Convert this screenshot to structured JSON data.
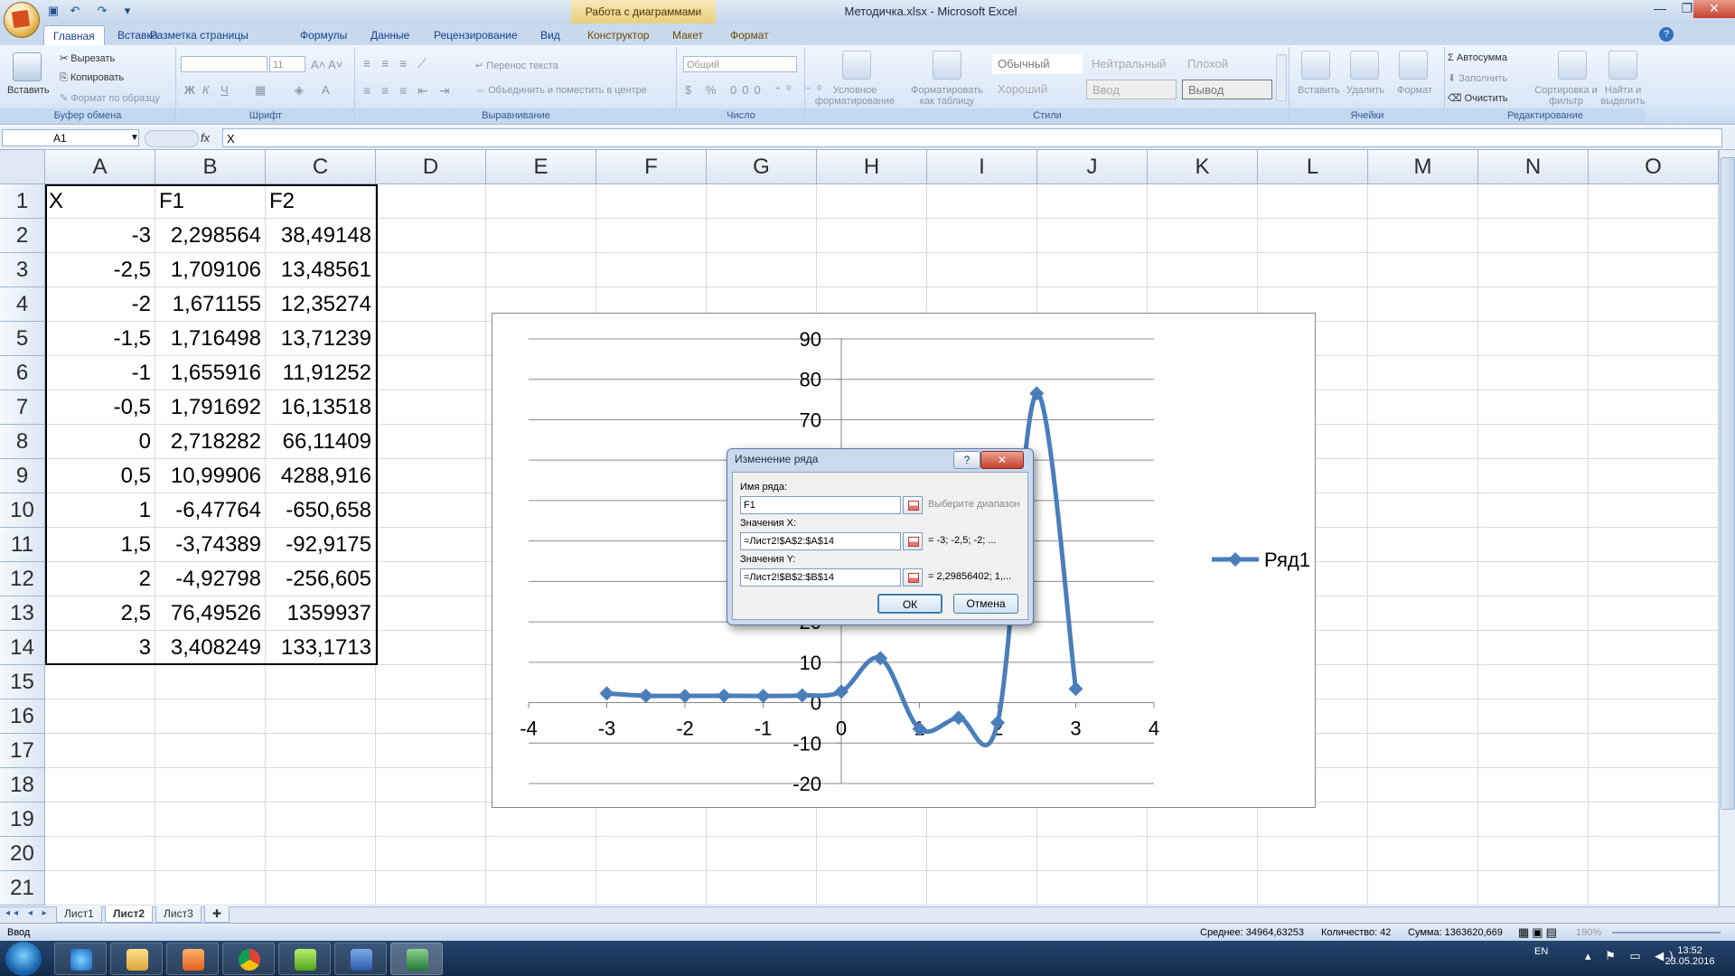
{
  "window": {
    "title": "Методичка.xlsx - Microsoft Excel",
    "context_tab_title": "Работа с диаграммами"
  },
  "ribbon_tabs": [
    "Главная",
    "Вставка",
    "Разметка страницы",
    "Формулы",
    "Данные",
    "Рецензирование",
    "Вид",
    "Конструктор",
    "Макет",
    "Формат"
  ],
  "ribbon": {
    "clipboard": {
      "paste": "Вставить",
      "cut": "Вырезать",
      "copy": "Копировать",
      "format_painter": "Формат по образцу",
      "label": "Буфер обмена"
    },
    "font": {
      "size": "11",
      "label": "Шрифт"
    },
    "alignment": {
      "wrap": "Перенос текста",
      "merge": "Объединить и поместить в центре",
      "label": "Выравнивание"
    },
    "number": {
      "format": "Общий",
      "label": "Число"
    },
    "styles": {
      "conditional": "Условное форматирование",
      "as_table": "Форматировать как таблицу",
      "normal": "Обычный",
      "neutral": "Нейтральный",
      "bad": "Плохой",
      "good": "Хороший",
      "input": "Ввод",
      "output": "Вывод",
      "label": "Стили"
    },
    "cells": {
      "insert": "Вставить",
      "delete": "Удалить",
      "format": "Формат",
      "label": "Ячейки"
    },
    "editing": {
      "autosum": "Автосумма",
      "fill": "Заполнить",
      "clear": "Очистить",
      "sort": "Сортировка и фильтр",
      "find": "Найти и выделить",
      "label": "Редактирование"
    }
  },
  "formula_bar": {
    "name_box": "A1",
    "fx": "fx",
    "value": "X"
  },
  "columns": [
    "A",
    "B",
    "C",
    "D",
    "E",
    "F",
    "G",
    "H",
    "I",
    "J",
    "K",
    "L",
    "M",
    "N",
    "O"
  ],
  "rows": [
    "1",
    "2",
    "3",
    "4",
    "5",
    "6",
    "7",
    "8",
    "9",
    "10",
    "11",
    "12",
    "13",
    "14",
    "15",
    "16",
    "17",
    "18",
    "19",
    "20",
    "21"
  ],
  "cells": {
    "header": [
      "X",
      "F1",
      "F2"
    ],
    "A": [
      "-3",
      "-2,5",
      "-2",
      "-1,5",
      "-1",
      "-0,5",
      "0",
      "0,5",
      "1",
      "1,5",
      "2",
      "2,5",
      "3"
    ],
    "B": [
      "2,298564",
      "1,709106",
      "1,671155",
      "1,716498",
      "1,655916",
      "1,791692",
      "2,718282",
      "10,99906",
      "-6,47764",
      "-3,74389",
      "-4,92798",
      "76,49526",
      "3,408249"
    ],
    "C": [
      "38,49148",
      "13,48561",
      "12,35274",
      "13,71239",
      "11,91252",
      "16,13518",
      "66,11409",
      "4288,916",
      "-650,658",
      "-92,9175",
      "-256,605",
      "1359937",
      "133,1713"
    ]
  },
  "chart_data": {
    "type": "scatter",
    "title": "",
    "xlabel": "",
    "ylabel": "",
    "xlim": [
      -4,
      4
    ],
    "ylim": [
      -20,
      90
    ],
    "x_ticks": [
      "-4",
      "-3",
      "-2",
      "-1",
      "0",
      "1",
      "2",
      "3",
      "4"
    ],
    "y_ticks": [
      "-20",
      "-10",
      "0",
      "10",
      "20",
      "30",
      "40",
      "50",
      "60",
      "70",
      "80",
      "90"
    ],
    "grid": true,
    "legend_position": "right",
    "series": [
      {
        "name": "Ряд1",
        "color": "#4a7ebb",
        "x": [
          -3,
          -2.5,
          -2,
          -1.5,
          -1,
          -0.5,
          0,
          0.5,
          1,
          1.5,
          2,
          2.5,
          3
        ],
        "y": [
          2.298564,
          1.709106,
          1.671155,
          1.716498,
          1.655916,
          1.791692,
          2.718282,
          10.99906,
          -6.47764,
          -3.74389,
          -4.92798,
          76.49526,
          3.408249
        ]
      }
    ]
  },
  "dialog": {
    "title": "Изменение ряда",
    "help": "?",
    "close": "✕",
    "name_label": "Имя ряда:",
    "name_value": "F1",
    "name_hint": "Выберите диапазон",
    "x_label": "Значения X:",
    "x_value": "=Лист2!$A$2:$A$14",
    "x_preview": "= -3; -2,5; -2; ...",
    "y_label": "Значения Y:",
    "y_value": "=Лист2!$B$2:$B$14",
    "y_preview": "= 2,29856402; 1,...",
    "ok": "ОК",
    "cancel": "Отмена"
  },
  "sheet_tabs": [
    "Лист1",
    "Лист2",
    "Лист3"
  ],
  "status": {
    "mode": "Ввод",
    "average": "Среднее: 34964,63253",
    "count": "Количество: 42",
    "sum": "Сумма: 1363620,669",
    "zoom": "190%"
  },
  "taskbar": {
    "lang": "EN",
    "time": "13:52",
    "date": "23.05.2016"
  }
}
